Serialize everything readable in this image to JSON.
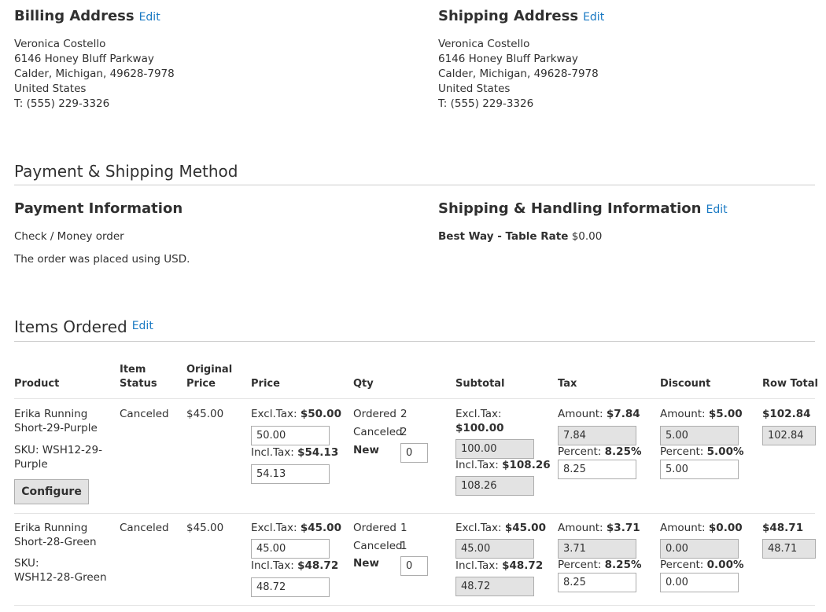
{
  "billing": {
    "title": "Billing Address",
    "edit": "Edit",
    "lines": [
      "Veronica Costello",
      "6146 Honey Bluff Parkway",
      "Calder, Michigan, 49628-7978",
      "United States",
      "T: (555) 229-3326"
    ]
  },
  "shipping": {
    "title": "Shipping Address",
    "edit": "Edit",
    "lines": [
      "Veronica Costello",
      "6146 Honey Bluff Parkway",
      "Calder, Michigan, 49628-7978",
      "United States",
      "T: (555) 229-3326"
    ]
  },
  "payment_shipping": {
    "title": "Payment & Shipping Method",
    "payment": {
      "title": "Payment Information",
      "method": "Check / Money order",
      "currency_note": "The order was placed using USD."
    },
    "handling": {
      "title": "Shipping & Handling Information",
      "edit": "Edit",
      "method_name": "Best Way - Table Rate",
      "amount": "$0.00"
    }
  },
  "items": {
    "title": "Items Ordered",
    "edit": "Edit",
    "headers": {
      "product": "Product",
      "item_status_1": "Item",
      "item_status_2": "Status",
      "original_price_1": "Original",
      "original_price_2": "Price",
      "price": "Price",
      "qty": "Qty",
      "subtotal": "Subtotal",
      "tax": "Tax",
      "discount": "Discount",
      "row_total": "Row Total"
    },
    "labels": {
      "excl_tax": "Excl.Tax:",
      "incl_tax": "Incl.Tax:",
      "ordered": "Ordered",
      "canceled": "Canceled",
      "new": "New",
      "amount": "Amount:",
      "percent": "Percent:",
      "sku": "SKU:"
    },
    "rows": [
      {
        "name_1": "Erika Running",
        "name_2": "Short-29-Purple",
        "sku_1": "WSH12-29-",
        "sku_2": "Purple",
        "configure": "Configure",
        "status": "Canceled",
        "original_price": "$45.00",
        "price_excl": "$50.00",
        "price_excl_input": "50.00",
        "price_incl": "$54.13",
        "price_incl_input": "54.13",
        "qty_ordered": "2",
        "qty_canceled": "2",
        "qty_new": "0",
        "subtotal_excl": "$100.00",
        "subtotal_excl_input": "100.00",
        "subtotal_incl": "$108.26",
        "subtotal_incl_input": "108.26",
        "tax_amount": "$7.84",
        "tax_amount_input": "7.84",
        "tax_percent": "8.25%",
        "tax_percent_input": "8.25",
        "discount_amount": "$5.00",
        "discount_amount_input": "5.00",
        "discount_percent": "5.00%",
        "discount_percent_input": "5.00",
        "row_total": "$102.84",
        "row_total_input": "102.84"
      },
      {
        "name_1": "Erika Running",
        "name_2": "Short-28-Green",
        "sku_1": "WSH12-28-Green",
        "status": "Canceled",
        "original_price": "$45.00",
        "price_excl": "$45.00",
        "price_excl_input": "45.00",
        "price_incl": "$48.72",
        "price_incl_input": "48.72",
        "qty_ordered": "1",
        "qty_canceled": "1",
        "qty_new": "0",
        "subtotal_excl": "$45.00",
        "subtotal_excl_input": "45.00",
        "subtotal_incl": "$48.72",
        "subtotal_incl_input": "48.72",
        "tax_amount": "$3.71",
        "tax_amount_input": "3.71",
        "tax_percent": "8.25%",
        "tax_percent_input": "8.25",
        "discount_amount": "$0.00",
        "discount_amount_input": "0.00",
        "discount_percent": "0.00%",
        "discount_percent_input": "0.00",
        "row_total": "$48.71",
        "row_total_input": "48.71"
      }
    ]
  },
  "colors": {
    "link": "#1979c3",
    "text": "#303030",
    "readonly_bg": "#e3e3e3",
    "divider": "#cccccc"
  }
}
